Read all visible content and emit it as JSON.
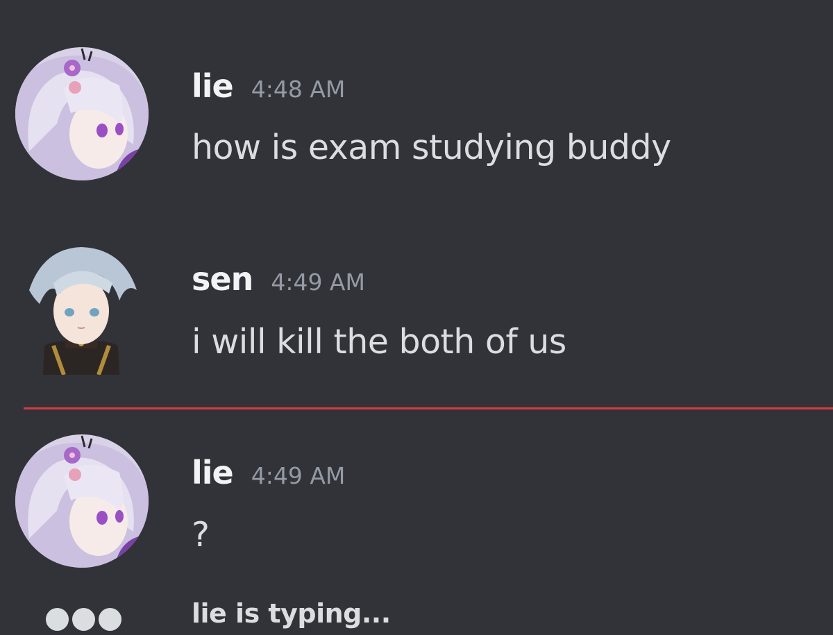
{
  "messages": [
    {
      "username": "lie",
      "timestamp": "4:48 AM",
      "content": "how is exam studying buddy",
      "avatar": "purple-haired-anime-avatar"
    },
    {
      "username": "sen",
      "timestamp": "4:49 AM",
      "content": "i will kill the both of us",
      "avatar": "silver-haired-anime-avatar"
    },
    {
      "username": "lie",
      "timestamp": "4:49 AM",
      "content": "?",
      "avatar": "purple-haired-anime-avatar"
    }
  ],
  "typing_indicator": {
    "text": "lie is typing..."
  },
  "colors": {
    "background": "#313338",
    "username": "#f2f3f5",
    "timestamp": "#949ba4",
    "message_text": "#dbdee1",
    "new_messages_divider": "#d83a42"
  }
}
